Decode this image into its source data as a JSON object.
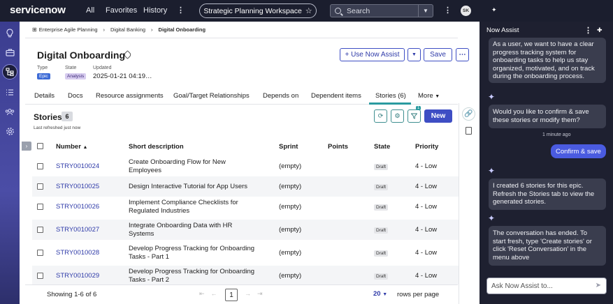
{
  "topbar": {
    "logo": "servicenow",
    "nav": [
      "All",
      "Favorites",
      "History"
    ],
    "workspace": "Strategic Planning Workspace",
    "search_placeholder": "Search",
    "avatar_initials": "SK"
  },
  "breadcrumb": [
    "Enterprise Agile Planning",
    "Digital Banking",
    "Digital Onboarding"
  ],
  "record": {
    "title": "Digital Onboarding",
    "type_label": "Type",
    "type_value": "Epic",
    "state_label": "State",
    "state_value": "Analysis",
    "updated_label": "Updated",
    "updated_value": "2025-01-21 04:19…",
    "use_now_assist": "+ Use Now Assist",
    "save": "Save"
  },
  "tabs": [
    "Details",
    "Docs",
    "Resource assignments",
    "Goal/Target Relationships",
    "Depends on",
    "Dependent items",
    "Stories (6)",
    "More"
  ],
  "stories": {
    "title": "Stories",
    "count": "6",
    "refreshed": "Last refreshed just now",
    "filter_badge": "1",
    "new_button": "New",
    "columns": [
      "Number",
      "Short description",
      "Sprint",
      "Points",
      "State",
      "Priority"
    ],
    "rows": [
      {
        "number": "STRY0010024",
        "desc1": "Create Onboarding Flow for New",
        "desc2": "Employees",
        "sprint": "(empty)",
        "state": "Draft",
        "priority": "4 - Low"
      },
      {
        "number": "STRY0010025",
        "desc1": "Design Interactive Tutorial for App Users",
        "desc2": "",
        "sprint": "(empty)",
        "state": "Draft",
        "priority": "4 - Low"
      },
      {
        "number": "STRY0010026",
        "desc1": "Implement Compliance Checklists for",
        "desc2": "Regulated Industries",
        "sprint": "(empty)",
        "state": "Draft",
        "priority": "4 - Low"
      },
      {
        "number": "STRY0010027",
        "desc1": "Integrate Onboarding Data with HR",
        "desc2": "Systems",
        "sprint": "(empty)",
        "state": "Draft",
        "priority": "4 - Low"
      },
      {
        "number": "STRY0010028",
        "desc1": "Develop Progress Tracking for Onboarding",
        "desc2": "Tasks - Part 1",
        "sprint": "(empty)",
        "state": "Draft",
        "priority": "4 - Low"
      },
      {
        "number": "STRY0010029",
        "desc1": "Develop Progress Tracking for Onboarding",
        "desc2": "Tasks - Part 2",
        "sprint": "(empty)",
        "state": "Draft",
        "priority": "4 - Low"
      }
    ],
    "showing": "Showing 1-6 of 6",
    "page": "1",
    "rows_per_page_value": "20",
    "rows_per_page_label": "rows per page"
  },
  "now_assist": {
    "title": "Now Assist",
    "msg1": "As a user, we want to have a clear progress tracking system for onboarding tasks to help us stay organized, motivated, and on track during the onboarding process.",
    "msg2": "Would you like to confirm & save these stories or modify them?",
    "timestamp": "1 minute ago",
    "user_reply": "Confirm & save",
    "msg3": "I created 6 stories for this epic. Refresh the Stories tab to view the generated stories.",
    "msg4": "The conversation has ended. To start fresh, type 'Create stories' or click 'Reset Conversation' in the menu above",
    "input_placeholder": "Ask Now Assist to..."
  }
}
